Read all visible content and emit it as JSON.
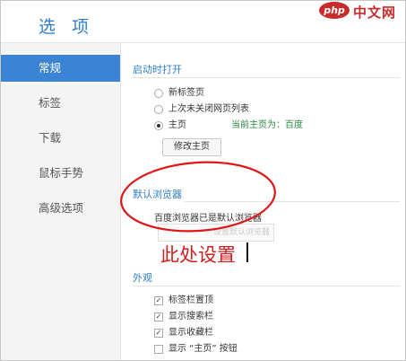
{
  "window": {
    "title": "选 项"
  },
  "watermark": {
    "brand": "php",
    "text": "中文网"
  },
  "sidebar": {
    "items": [
      {
        "label": "常规",
        "active": true
      },
      {
        "label": "标签",
        "active": false
      },
      {
        "label": "下载",
        "active": false
      },
      {
        "label": "鼠标手势",
        "active": false
      },
      {
        "label": "高级选项",
        "active": false
      }
    ]
  },
  "startup": {
    "title": "启动时打开",
    "options": [
      {
        "label": "新标签页",
        "checked": false
      },
      {
        "label": "上次未关闭网页列表",
        "checked": false
      },
      {
        "label": "主页",
        "checked": true
      }
    ],
    "homepage_note": "当前主页为：百度",
    "edit_homepage_button": "修改主页"
  },
  "default_browser": {
    "title": "默认浏览器",
    "status_text": "百度浏览器已是默认浏览器",
    "set_default_button": "设置默认浏览器"
  },
  "annotation": {
    "text": "此处设置"
  },
  "appearance": {
    "title": "外观",
    "options": [
      {
        "label": "标签栏置顶",
        "checked": true
      },
      {
        "label": "显示搜索栏",
        "checked": true
      },
      {
        "label": "显示收藏栏",
        "checked": true
      },
      {
        "label": "显示 “主页” 按钮",
        "checked": false
      }
    ]
  },
  "colors": {
    "accent": "#3b84d4",
    "title": "#2f7fc8",
    "annotation": "#d02020",
    "homepage_note": "#2a8a3f"
  }
}
